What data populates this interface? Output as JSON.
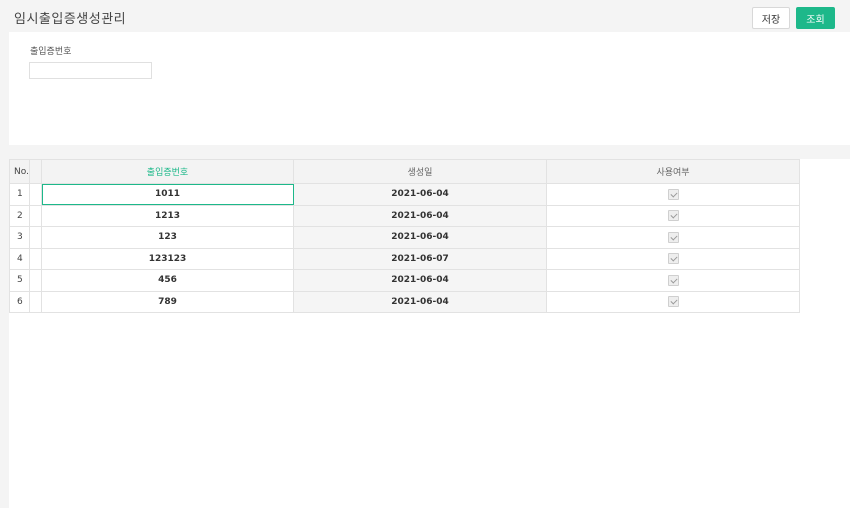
{
  "page": {
    "title": "임시출입증생성관리",
    "buttons": {
      "save_label": "저장",
      "search_label": "조회"
    }
  },
  "search": {
    "field_label": "출입증번호",
    "field_value": "",
    "field_placeholder": ""
  },
  "grid": {
    "columns": {
      "no": "No.",
      "pass_no": "출입증번호",
      "created": "생성일",
      "in_use": "사용여부"
    },
    "rows": [
      {
        "no": "1",
        "pass_no": "1011",
        "created": "2021-06-04",
        "in_use": true
      },
      {
        "no": "2",
        "pass_no": "1213",
        "created": "2021-06-04",
        "in_use": true
      },
      {
        "no": "3",
        "pass_no": "123",
        "created": "2021-06-04",
        "in_use": true
      },
      {
        "no": "4",
        "pass_no": "123123",
        "created": "2021-06-07",
        "in_use": true
      },
      {
        "no": "5",
        "pass_no": "456",
        "created": "2021-06-04",
        "in_use": true
      },
      {
        "no": "6",
        "pass_no": "789",
        "created": "2021-06-04",
        "in_use": true
      }
    ]
  },
  "colors": {
    "accent": "#1db88a",
    "background": "#f4f4f4"
  }
}
